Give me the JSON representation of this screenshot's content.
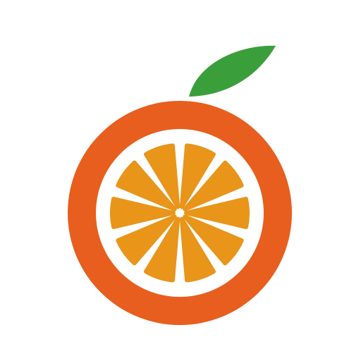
{
  "logo": {
    "icon": "orange-slice-icon",
    "segment_count": 10,
    "colors": {
      "background": "#ffffff",
      "rind": "#E85E1E",
      "pith": "#ffffff",
      "segment": "#E8951A",
      "leaf": "#3A9F3A"
    }
  }
}
